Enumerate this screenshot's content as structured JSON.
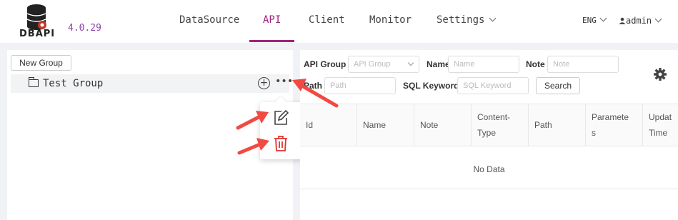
{
  "header": {
    "logo_text": "DBAPI",
    "version": "4.0.29",
    "nav": [
      {
        "label": "DataSource"
      },
      {
        "label": "API"
      },
      {
        "label": "Client"
      },
      {
        "label": "Monitor"
      },
      {
        "label": "Settings"
      }
    ],
    "active_nav": "API",
    "language": "ENG",
    "user": "admin"
  },
  "left_panel": {
    "new_group_label": "New Group",
    "groups": [
      {
        "name": "Test Group"
      }
    ],
    "group_actions": [
      "add",
      "more"
    ],
    "popup_actions": [
      "edit",
      "delete"
    ]
  },
  "filters": {
    "api_group_label": "API Group",
    "api_group_placeholder": "API Group",
    "name_label": "Name",
    "name_placeholder": "Name",
    "note_label": "Note",
    "note_placeholder": "Note",
    "path_label": "Path",
    "path_placeholder": "Path",
    "sql_label": "SQL Keyword",
    "sql_placeholder": "SQL Keyword",
    "search_label": "Search"
  },
  "table": {
    "columns": [
      {
        "line1": "Id",
        "line2": ""
      },
      {
        "line1": "Name",
        "line2": ""
      },
      {
        "line1": "Note",
        "line2": ""
      },
      {
        "line1": "Content-",
        "line2": "Type"
      },
      {
        "line1": "Path",
        "line2": ""
      },
      {
        "line1": "Paramete",
        "line2": "s"
      },
      {
        "line1": "Updat",
        "line2": "Time"
      }
    ],
    "empty_text": "No Data"
  },
  "colors": {
    "accent": "#a0227f",
    "version": "#8e44ad",
    "delete": "#e0342f",
    "annotation_arrow": "#f04a42"
  }
}
